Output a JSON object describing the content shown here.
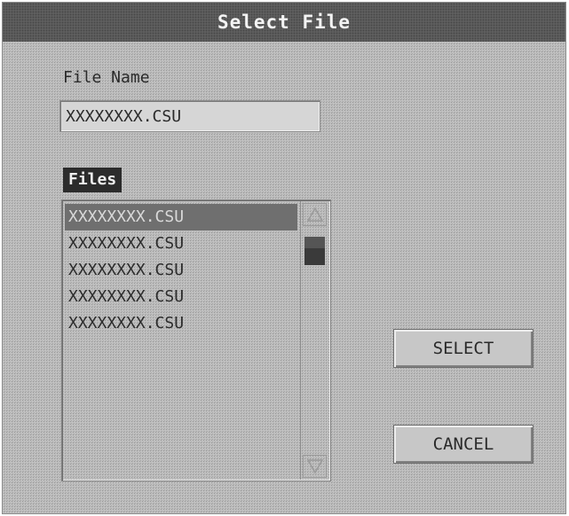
{
  "window": {
    "title": "Select File"
  },
  "file_name": {
    "label": "File Name",
    "value": "XXXXXXXX.CSU"
  },
  "files": {
    "label": "Files",
    "items": [
      "XXXXXXXX.CSU",
      "XXXXXXXX.CSU",
      "XXXXXXXX.CSU",
      "XXXXXXXX.CSU",
      "XXXXXXXX.CSU"
    ],
    "selected_index": 0
  },
  "scrollbar": {
    "up_icon": "triangle-up-icon",
    "down_icon": "triangle-down-icon"
  },
  "buttons": {
    "select_label": "SELECT",
    "cancel_label": "CANCEL"
  }
}
